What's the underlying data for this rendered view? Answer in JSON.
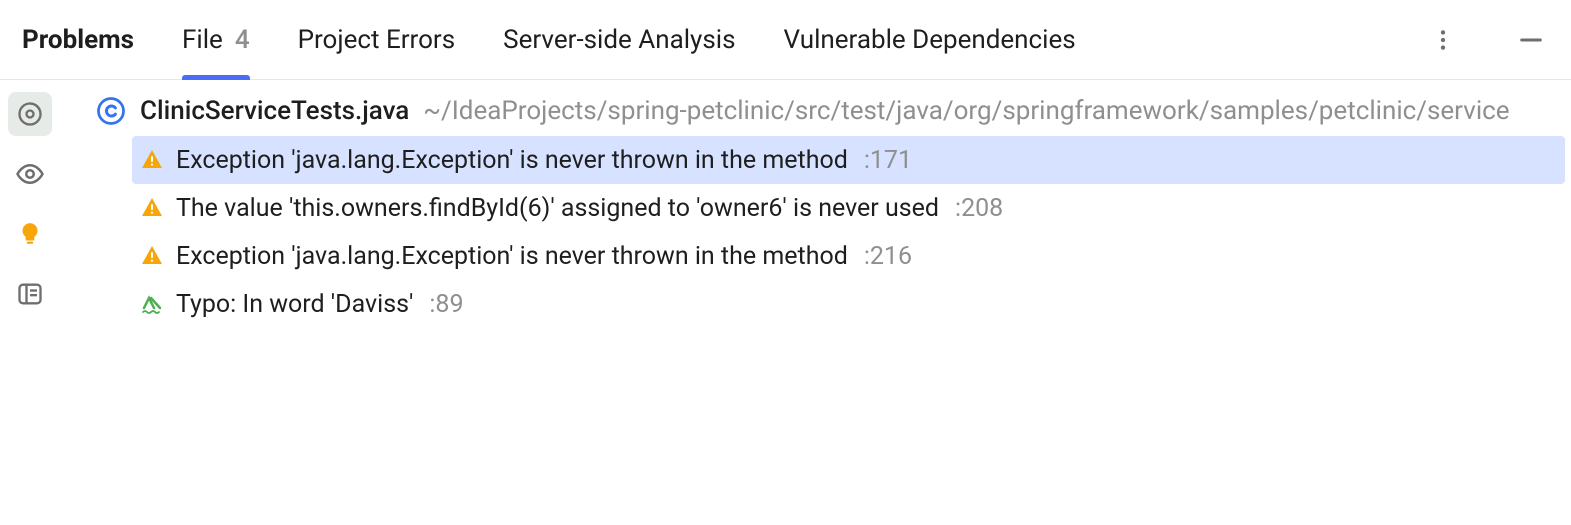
{
  "tabs": {
    "problems": "Problems",
    "file": "File",
    "file_count": "4",
    "project_errors": "Project Errors",
    "server_side": "Server-side Analysis",
    "vulnerable": "Vulnerable Dependencies"
  },
  "file": {
    "name": "ClinicServiceTests.java",
    "path": "~/IdeaProjects/spring-petclinic/src/test/java/org/springframework/samples/petclinic/service"
  },
  "problems": [
    {
      "icon": "warning",
      "message": "Exception 'java.lang.Exception' is never thrown in the method",
      "line": ":171",
      "selected": true
    },
    {
      "icon": "warning",
      "message": "The value 'this.owners.findById(6)' assigned to 'owner6' is never used",
      "line": ":208",
      "selected": false
    },
    {
      "icon": "warning",
      "message": "Exception 'java.lang.Exception' is never thrown in the method",
      "line": ":216",
      "selected": false
    },
    {
      "icon": "typo",
      "message": "Typo: In word 'Daviss'",
      "line": ":89",
      "selected": false
    }
  ]
}
